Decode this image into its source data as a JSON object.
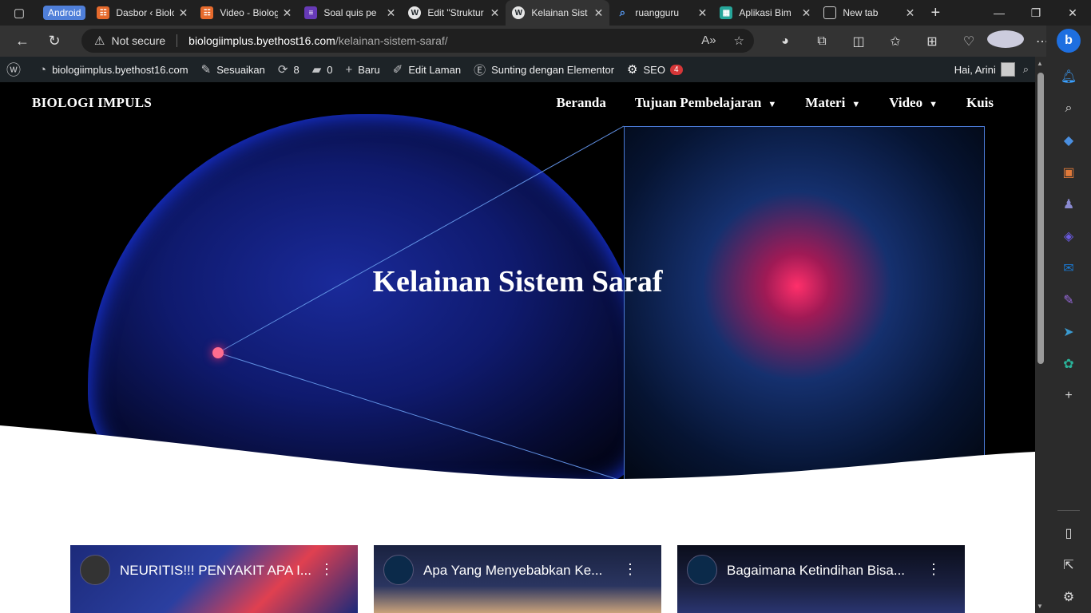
{
  "browser": {
    "tab_group_label": "Android",
    "tabs": [
      {
        "title": "Dasbor ‹ Biologi",
        "favicon": "xampp-icon",
        "color": "#e66a2c",
        "active": false
      },
      {
        "title": "Video - Biologi",
        "favicon": "xampp-icon",
        "color": "#e66a2c",
        "active": false
      },
      {
        "title": "Soal quis pe",
        "favicon": "forms-icon",
        "color": "#673ab7",
        "active": false
      },
      {
        "title": "Edit \"Struktur",
        "favicon": "wordpress-icon",
        "color": "#e6e6e6",
        "active": false
      },
      {
        "title": "Kelainan Sist",
        "favicon": "wordpress-icon",
        "color": "#e6e6e6",
        "active": true
      },
      {
        "title": "ruangguru",
        "favicon": "search-icon",
        "color": "#5aa0ff",
        "active": false
      },
      {
        "title": "Aplikasi Bim",
        "favicon": "app-icon",
        "color": "#26a69a",
        "active": false
      },
      {
        "title": "New tab",
        "favicon": "newtab-icon",
        "color": "#cccccc",
        "active": false
      }
    ],
    "address": {
      "security_label": "Not secure",
      "host": "biologiimplus.byethost16.com",
      "path": "/kelainan-sistem-saraf/"
    }
  },
  "wp_admin_bar": {
    "site": "biologiimplus.byethost16.com",
    "customize": "Sesuaikan",
    "updates_count": "8",
    "comments_count": "0",
    "new": "Baru",
    "edit_page": "Edit Laman",
    "elementor": "Sunting dengan Elementor",
    "seo": "SEO",
    "seo_badge": "4",
    "greeting": "Hai, Arini"
  },
  "site": {
    "title": "BIOLOGI IMPULS",
    "nav": [
      {
        "label": "Beranda",
        "has_dropdown": false
      },
      {
        "label": "Tujuan Pembelajaran",
        "has_dropdown": true
      },
      {
        "label": "Materi",
        "has_dropdown": true
      },
      {
        "label": "Video",
        "has_dropdown": true
      },
      {
        "label": "Kuis",
        "has_dropdown": false
      }
    ],
    "hero_heading": "Kelainan Sistem Saraf"
  },
  "videos": [
    {
      "title": "NEURITIS!!! PENYAKIT APA I...",
      "bg": "#1c2a7a"
    },
    {
      "title": "Apa Yang Menyebabkan Ke...",
      "bg": "#1a2240"
    },
    {
      "title": "Bagaimana Ketindihan Bisa...",
      "bg": "#101528"
    }
  ],
  "colors": {
    "wp_bar": "#1d2327",
    "hero_bg": "#000000",
    "accent_blue": "#4a7ad6",
    "neuron_red": "#ff2f6a",
    "seo_badge": "#d63638"
  }
}
